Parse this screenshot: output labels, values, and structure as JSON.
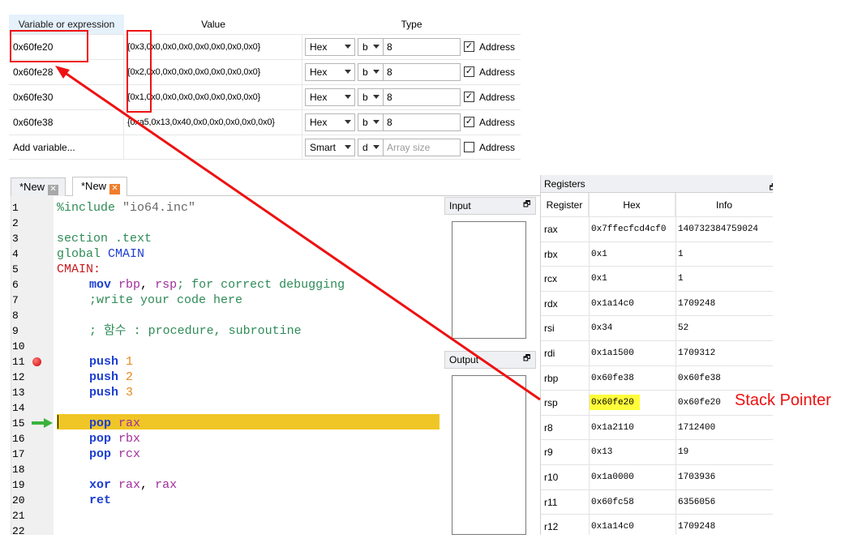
{
  "watch": {
    "headers": {
      "variable": "Variable or expression",
      "value": "Value",
      "type": "Type"
    },
    "rows": [
      {
        "expr": "0x60fe20",
        "value": "{0x3,0x0,0x0,0x0,0x0,0x0,0x0,0x0}",
        "format": "Hex",
        "width": "b",
        "size": "8",
        "address_label": "Address",
        "address_checked": true
      },
      {
        "expr": "0x60fe28",
        "value": "{0x2,0x0,0x0,0x0,0x0,0x0,0x0,0x0}",
        "format": "Hex",
        "width": "b",
        "size": "8",
        "address_label": "Address",
        "address_checked": true
      },
      {
        "expr": "0x60fe30",
        "value": "{0x1,0x0,0x0,0x0,0x0,0x0,0x0,0x0}",
        "format": "Hex",
        "width": "b",
        "size": "8",
        "address_label": "Address",
        "address_checked": true
      },
      {
        "expr": "0x60fe38",
        "value": "{0xa5,0x13,0x40,0x0,0x0,0x0,0x0,0x0}",
        "format": "Hex",
        "width": "b",
        "size": "8",
        "address_label": "Address",
        "address_checked": true
      }
    ],
    "add_row": {
      "label": "Add variable...",
      "format": "Smart",
      "width": "d",
      "size_placeholder": "Array size",
      "address_label": "Address",
      "address_checked": false
    }
  },
  "tabs": [
    {
      "label": "*New",
      "active": false
    },
    {
      "label": "*New",
      "active": true
    }
  ],
  "editor": {
    "line_numbers": [
      "1",
      "2",
      "3",
      "4",
      "5",
      "6",
      "7",
      "8",
      "9",
      "10",
      "11",
      "12",
      "13",
      "14",
      "15",
      "16",
      "17",
      "18",
      "19",
      "20",
      "21",
      "22"
    ],
    "code": {
      "l1_directive": "%include",
      "l1_file": "\"io64.inc\"",
      "l3_a": "section",
      "l3_b": ".text",
      "l4_a": "global",
      "l4_b": "CMAIN",
      "l5": "CMAIN:",
      "l6_instr": "mov",
      "l6_ops1": "rbp",
      "l6_comma": ",",
      "l6_ops2": "rsp",
      "l6_comment": "; for correct debugging",
      "l7_comment": ";write your code here",
      "l9_comment": "; 함수 : procedure, subroutine",
      "l11_instr": "push",
      "l11_op": "1",
      "l12_instr": "push",
      "l12_op": "2",
      "l13_instr": "push",
      "l13_op": "3",
      "l15_instr": "pop",
      "l15_op": "rax",
      "l16_instr": "pop",
      "l16_op": "rbx",
      "l17_instr": "pop",
      "l17_op": "rcx",
      "l19_instr": "xor",
      "l19_op1": "rax",
      "l19_comma": ",",
      "l19_op2": "rax",
      "l20_instr": "ret"
    },
    "breakpoint_line": "11",
    "current_line": "15"
  },
  "input_panel": {
    "title": "Input"
  },
  "output_panel": {
    "title": "Output"
  },
  "registers": {
    "title": "Registers",
    "headers": {
      "name": "Register",
      "hex": "Hex",
      "info": "Info"
    },
    "rows": [
      {
        "name": "rax",
        "hex": "0x7ffecfcd4cf0",
        "info": "140732384759024"
      },
      {
        "name": "rbx",
        "hex": "0x1",
        "info": "1"
      },
      {
        "name": "rcx",
        "hex": "0x1",
        "info": "1"
      },
      {
        "name": "rdx",
        "hex": "0x1a14c0",
        "info": "1709248"
      },
      {
        "name": "rsi",
        "hex": "0x34",
        "info": "52"
      },
      {
        "name": "rdi",
        "hex": "0x1a1500",
        "info": "1709312"
      },
      {
        "name": "rbp",
        "hex": "0x60fe38",
        "info": "0x60fe38"
      },
      {
        "name": "rsp",
        "hex": "0x60fe20",
        "info": "0x60fe20"
      },
      {
        "name": "r8",
        "hex": "0x1a2110",
        "info": "1712400"
      },
      {
        "name": "r9",
        "hex": "0x13",
        "info": "19"
      },
      {
        "name": "r10",
        "hex": "0x1a0000",
        "info": "1703936"
      },
      {
        "name": "r11",
        "hex": "0x60fc58",
        "info": "6356056"
      },
      {
        "name": "r12",
        "hex": "0x1a14c0",
        "info": "1709248"
      }
    ]
  },
  "annotation": {
    "label": "Stack Pointer",
    "color": "#ee1111"
  },
  "colors": {
    "highlight_line": "#f0c626",
    "register_highlight": "#fffc3a",
    "header_selected": "#e5f1fb"
  }
}
